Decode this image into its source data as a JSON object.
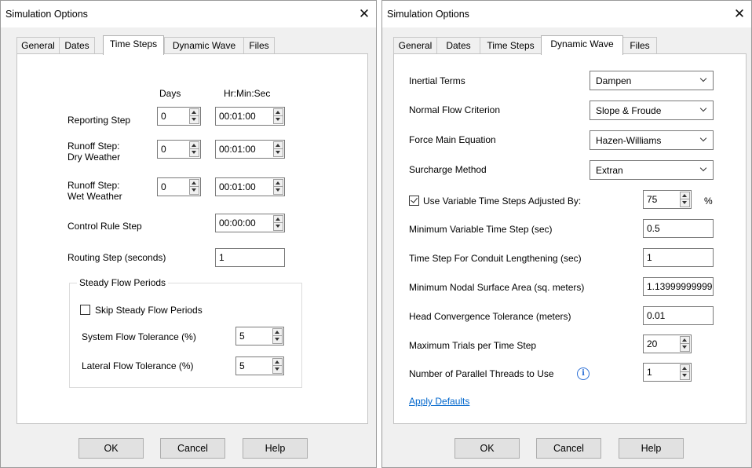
{
  "left_dialog": {
    "title": "Simulation Options",
    "close_glyph": "✕",
    "tabs": [
      {
        "label": "General",
        "active": false
      },
      {
        "label": "Dates",
        "active": false
      },
      {
        "label": "Time Steps",
        "active": true
      },
      {
        "label": "Dynamic Wave",
        "active": false
      },
      {
        "label": "Files",
        "active": false
      }
    ],
    "headers": {
      "days": "Days",
      "hms": "Hr:Min:Sec"
    },
    "reporting_step": {
      "label": "Reporting Step",
      "days": "0",
      "time": "00:01:00"
    },
    "runoff_dry": {
      "label_line1": "Runoff Step:",
      "label_line2": "Dry Weather",
      "days": "0",
      "time": "00:01:00"
    },
    "runoff_wet": {
      "label_line1": "Runoff Step:",
      "label_line2": "Wet Weather",
      "days": "0",
      "time": "00:01:00"
    },
    "control_rule": {
      "label": "Control Rule Step",
      "time": "00:00:00"
    },
    "routing_step": {
      "label": "Routing Step (seconds)",
      "value": "1"
    },
    "steady_flow": {
      "group_title": "Steady Flow Periods",
      "skip_label": "Skip Steady Flow Periods",
      "skip_checked": false,
      "system_tol_label": "System Flow Tolerance (%)",
      "system_tol_value": "5",
      "lateral_tol_label": "Lateral Flow Tolerance (%)",
      "lateral_tol_value": "5"
    },
    "buttons": {
      "ok": "OK",
      "cancel": "Cancel",
      "help": "Help"
    }
  },
  "right_dialog": {
    "title": "Simulation Options",
    "close_glyph": "✕",
    "tabs": [
      {
        "label": "General",
        "active": false
      },
      {
        "label": "Dates",
        "active": false
      },
      {
        "label": "Time Steps",
        "active": false
      },
      {
        "label": "Dynamic Wave",
        "active": true
      },
      {
        "label": "Files",
        "active": false
      }
    ],
    "inertial_terms": {
      "label": "Inertial Terms",
      "value": "Dampen"
    },
    "normal_flow": {
      "label": "Normal Flow Criterion",
      "value": "Slope & Froude"
    },
    "force_main": {
      "label": "Force Main Equation",
      "value": "Hazen-Williams"
    },
    "surcharge": {
      "label": "Surcharge Method",
      "value": "Extran"
    },
    "variable_steps": {
      "label": "Use Variable Time Steps Adjusted By:",
      "checked": true,
      "value": "75",
      "unit": "%"
    },
    "min_variable_step": {
      "label": "Minimum Variable Time Step (sec)",
      "value": "0.5"
    },
    "conduit_lengthening": {
      "label": "Time Step For Conduit Lengthening (sec)",
      "value": "1"
    },
    "min_nodal_area": {
      "label": "Minimum Nodal Surface Area (sq. meters)",
      "value": "1.13999999999"
    },
    "head_convergence": {
      "label": "Head Convergence Tolerance (meters)",
      "value": "0.01"
    },
    "max_trials": {
      "label": "Maximum Trials per Time Step",
      "value": "20"
    },
    "parallel_threads": {
      "label": "Number of Parallel Threads to Use",
      "value": "1",
      "info_glyph": "i"
    },
    "apply_defaults": "Apply Defaults",
    "buttons": {
      "ok": "OK",
      "cancel": "Cancel",
      "help": "Help"
    }
  }
}
